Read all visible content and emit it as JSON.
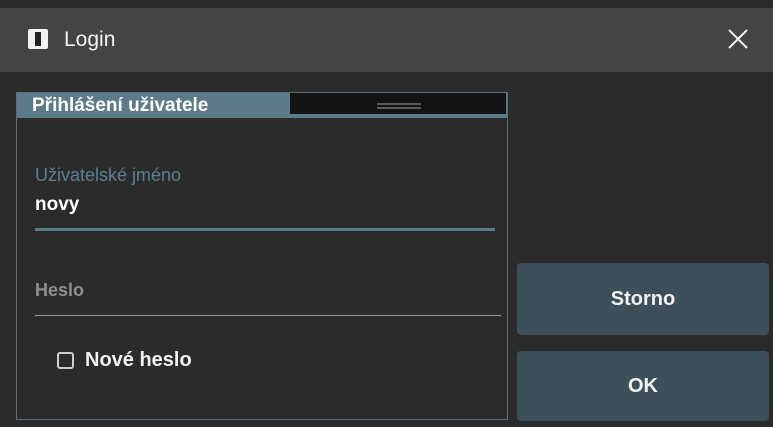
{
  "window": {
    "title": "Login",
    "close_icon": "close-icon",
    "app_icon": "app-icon"
  },
  "panel": {
    "header": "Přihlášení uživatele"
  },
  "form": {
    "username_label": "Uživatelské jméno",
    "username_value": "novy",
    "password_label": "Heslo",
    "new_password_label": "Nové heslo",
    "new_password_checked": false
  },
  "buttons": {
    "cancel_label": "Storno",
    "ok_label": "OK"
  },
  "colors": {
    "accent": "#5d7a89",
    "button_bg": "#3d505a",
    "background": "#2b2b2b",
    "titlebar": "#444444"
  }
}
